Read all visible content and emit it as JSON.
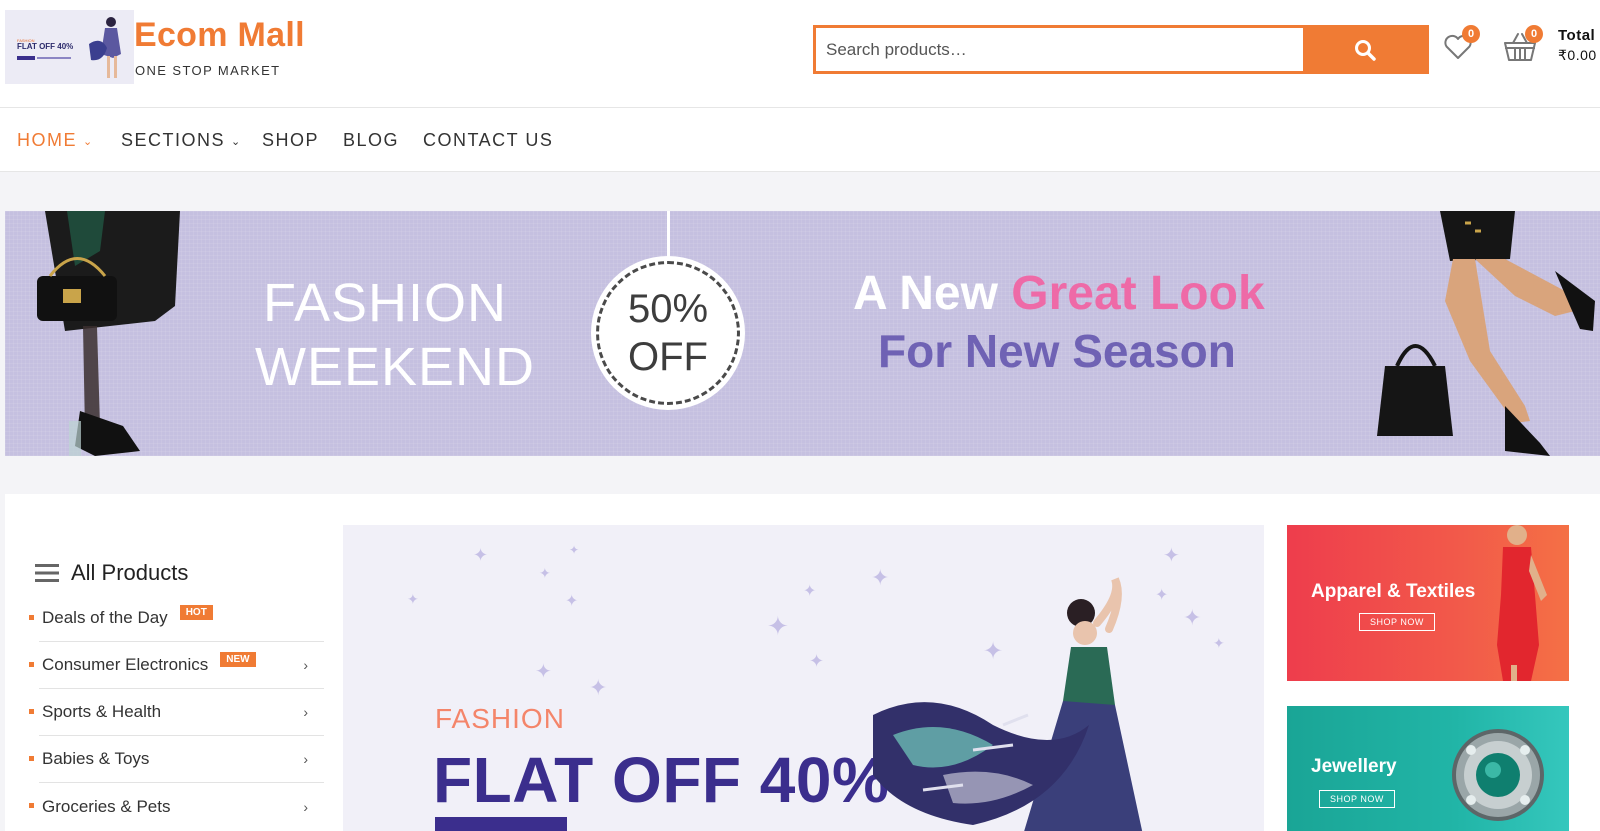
{
  "header": {
    "logo_image_text": "FLAT OFF 40%",
    "logo_image_tag": "FASHION",
    "brand_title": "Ecom Mall",
    "brand_subtitle": "ONE STOP MARKET",
    "search": {
      "placeholder": "Search products…",
      "value": ""
    },
    "wishlist_count": "0",
    "cart_count": "0",
    "total_label": "Total",
    "total_value": "₹0.00"
  },
  "nav": {
    "items": [
      {
        "label": "HOME",
        "active": true,
        "has_dropdown": true
      },
      {
        "label": "SECTIONS",
        "active": false,
        "has_dropdown": true
      },
      {
        "label": "SHOP",
        "active": false,
        "has_dropdown": false
      },
      {
        "label": "BLOG",
        "active": false,
        "has_dropdown": false
      },
      {
        "label": "CONTACT US",
        "active": false,
        "has_dropdown": false
      }
    ]
  },
  "hero": {
    "fashion_line1": "FASHION",
    "fashion_line2": "WEEKEND",
    "discount_line1": "50%",
    "discount_line2": "OFF",
    "tagline_a": "A New ",
    "tagline_b": "Great Look",
    "tagline_line2": "For New Season"
  },
  "categories": {
    "title": "All Products",
    "items": [
      {
        "label": "Deals of the Day",
        "badge": "HOT",
        "arrow": false
      },
      {
        "label": "Consumer Electronics",
        "badge": "NEW",
        "arrow": true
      },
      {
        "label": "Sports & Health",
        "badge": "",
        "arrow": true
      },
      {
        "label": "Babies & Toys",
        "badge": "",
        "arrow": true
      },
      {
        "label": "Groceries & Pets",
        "badge": "",
        "arrow": true
      }
    ]
  },
  "main_banner": {
    "kicker": "FASHION",
    "headline": "FLAT OFF 40%"
  },
  "side_banners": [
    {
      "title": "Apparel & Textiles",
      "button": "SHOP NOW"
    },
    {
      "title": "Jewellery",
      "button": "SHOP NOW"
    }
  ],
  "colors": {
    "accent": "#f07b34",
    "hero_bg": "#c5c0e0",
    "pink": "#ee6aa7",
    "purple": "#3b2e8d"
  }
}
